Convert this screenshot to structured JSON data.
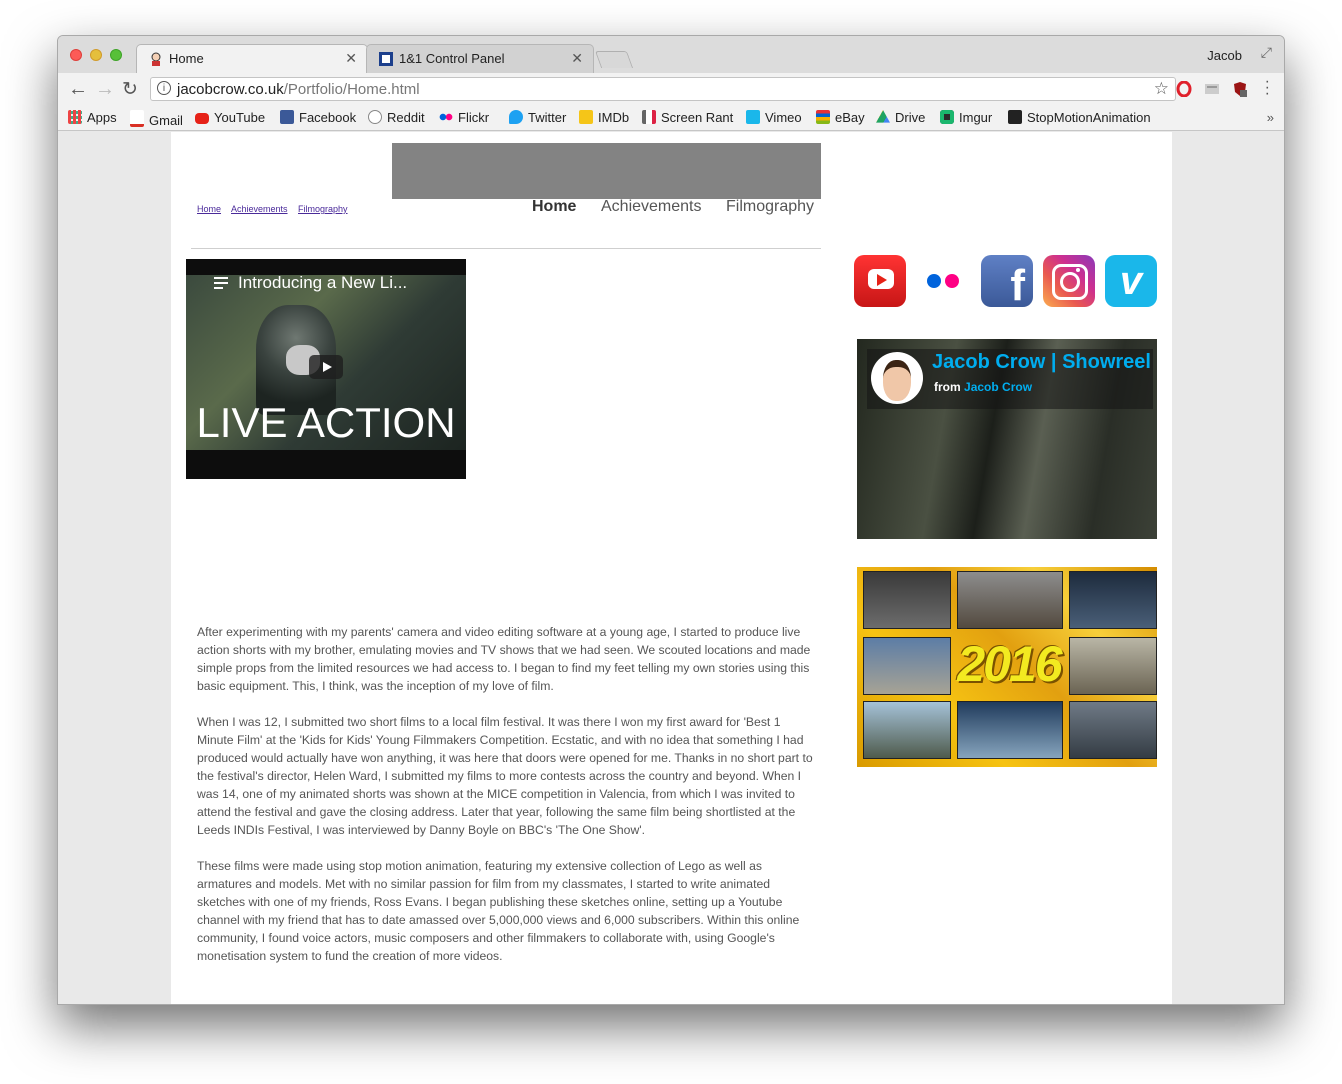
{
  "browser": {
    "tabs": [
      {
        "title": "Home",
        "active": true
      },
      {
        "title": "1&1 Control Panel",
        "active": false
      }
    ],
    "profile_name": "Jacob",
    "url_host": "jacobcrow.co.uk",
    "url_path": "/Portfolio/Home.html",
    "bookmarks": [
      {
        "label": "Apps",
        "icon": "apps-grid-icon",
        "color": "#e44"
      },
      {
        "label": "Gmail",
        "icon": "gmail-icon",
        "color": "#d93025"
      },
      {
        "label": "YouTube",
        "icon": "youtube-icon",
        "color": "#e62117"
      },
      {
        "label": "Facebook",
        "icon": "facebook-icon",
        "color": "#3b5998"
      },
      {
        "label": "Reddit",
        "icon": "reddit-icon",
        "color": "#888888"
      },
      {
        "label": "Flickr",
        "icon": "flickr-icon",
        "color": "#0063dc"
      },
      {
        "label": "Twitter",
        "icon": "twitter-icon",
        "color": "#1da1f2"
      },
      {
        "label": "IMDb",
        "icon": "imdb-icon",
        "color": "#f5c518"
      },
      {
        "label": "Screen Rant",
        "icon": "screenrant-icon",
        "color": "#555555"
      },
      {
        "label": "Vimeo",
        "icon": "vimeo-icon",
        "color": "#1ab7ea"
      },
      {
        "label": "eBay",
        "icon": "ebay-icon",
        "color": "#333333"
      },
      {
        "label": "Drive",
        "icon": "drive-icon",
        "color": "#1fa463"
      },
      {
        "label": "Imgur",
        "icon": "imgur-icon",
        "color": "#1bb76e"
      },
      {
        "label": "StopMotionAnimation",
        "icon": "stopmotion-icon",
        "color": "#222222"
      }
    ]
  },
  "site": {
    "breadcrumb": [
      "Home",
      "Achievements",
      "Filmography"
    ],
    "nav": [
      {
        "label": "Home",
        "active": true
      },
      {
        "label": "Achievements",
        "active": false
      },
      {
        "label": "Filmography",
        "active": false
      }
    ],
    "video": {
      "title": "Introducing a New Li...",
      "overlay_text": "LIVE ACTION"
    },
    "social_icons": [
      "youtube-icon",
      "flickr-icon",
      "facebook-icon",
      "instagram-icon",
      "vimeo-icon"
    ],
    "showreel": {
      "title": "Jacob Crow | Showreel",
      "from_label": "from",
      "from_name": "Jacob Crow"
    },
    "collage_year": "2016",
    "bio": [
      "After experimenting with my parents' camera and video editing software at a young age, I started to produce live action shorts with my brother, emulating movies and TV shows that we had seen. We scouted locations and made simple props from the limited resources we had access to. I began to find my feet telling my own stories using this basic equipment. This, I think, was the inception of my love of film.",
      "When I was 12, I submitted two short films to a local film festival. It was there I won my first award for 'Best 1 Minute Film' at the 'Kids for Kids' Young Filmmakers Competition. Ecstatic, and with no idea that something I had produced would actually have won anything, it was here that doors were opened for me. Thanks in no short part to the festival's director, Helen Ward, I submitted my films to more contests across the country and beyond. When I was 14, one of my animated shorts was shown at the MICE competition in Valencia, from which I was invited to attend the festival and gave the closing address. Later that year, following the same film being shortlisted at the Leeds INDIs Festival, I was interviewed by Danny Boyle on BBC's 'The One Show'.",
      "These films were made using stop motion animation, featuring my extensive collection of Lego as well as armatures and models. Met with no similar passion for film from my classmates, I started to write animated sketches with one of my friends, Ross Evans. I began publishing these sketches online, setting up a Youtube channel with my friend that has to date amassed over 5,000,000 views and 6,000 subscribers. Within this online community, I found voice actors, music composers and other filmmakers to collaborate with, using Google's monetisation system to fund the creation of more videos."
    ]
  }
}
